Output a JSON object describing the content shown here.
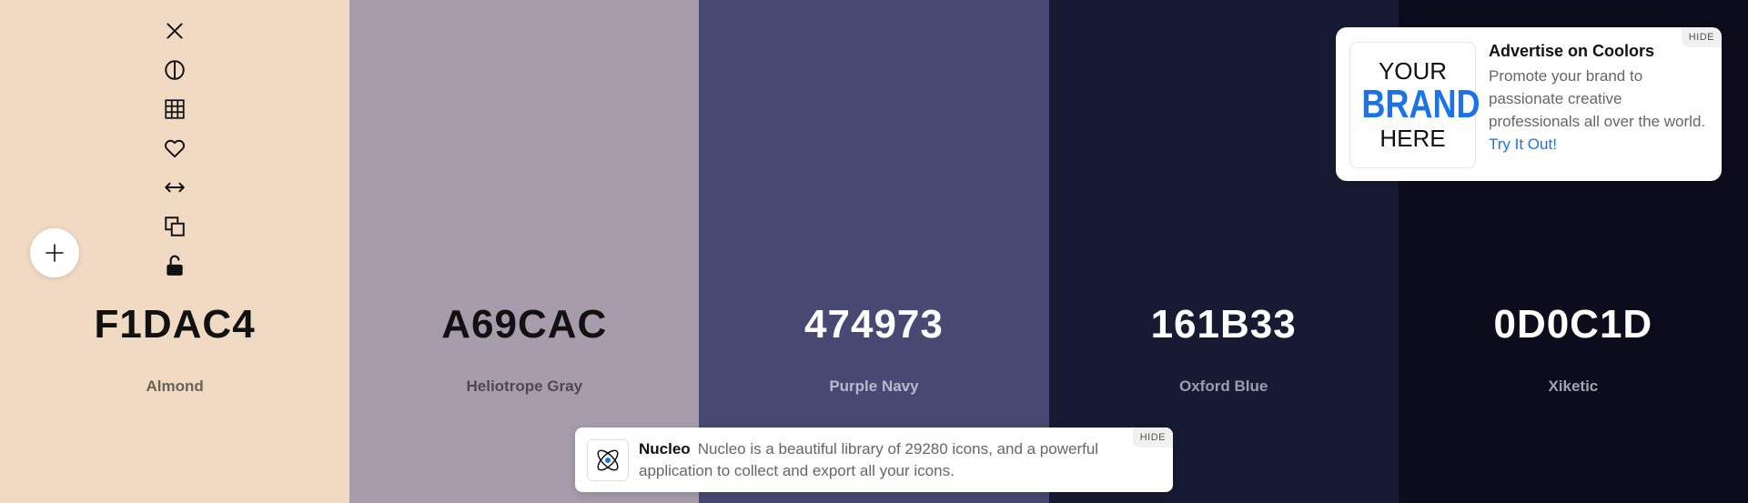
{
  "palette": {
    "colors": [
      {
        "hex": "F1DAC4",
        "name": "Almond",
        "bg": "#F1DAC4",
        "hex_color": "#111111",
        "name_color": "#6b6256"
      },
      {
        "hex": "A69CAC",
        "name": "Heliotrope Gray",
        "bg": "#A69CAC",
        "hex_color": "#111111",
        "name_color": "#4f4754"
      },
      {
        "hex": "474973",
        "name": "Purple Navy",
        "bg": "#474973",
        "hex_color": "#ffffff",
        "name_color": "#b8b9d0"
      },
      {
        "hex": "161B33",
        "name": "Oxford Blue",
        "bg": "#161B33",
        "hex_color": "#ffffff",
        "name_color": "#9a9db0"
      },
      {
        "hex": "0D0C1D",
        "name": "Xiketic",
        "bg": "#0D0C1D",
        "hex_color": "#ffffff",
        "name_color": "#a3a3ad"
      }
    ]
  },
  "toolbar": {
    "items": [
      "close-icon",
      "contrast-icon",
      "grid-icon",
      "heart-icon",
      "arrows-horizontal-icon",
      "copy-icon",
      "unlock-icon"
    ],
    "add_icon": "plus-icon"
  },
  "ad": {
    "logo_line1": "YOUR",
    "logo_line2": "BRAND",
    "logo_line3": "HERE",
    "title": "Advertise on Coolors",
    "body": "Promote your brand to passionate creative professionals all over the world.",
    "link": "Try It Out!",
    "hide_label": "HIDE"
  },
  "banner": {
    "title": "Nucleo",
    "body": "Nucleo is a beautiful library of 29280 icons, and a powerful application to collect and export all your icons.",
    "hide_label": "HIDE",
    "icon": "atom-icon"
  }
}
